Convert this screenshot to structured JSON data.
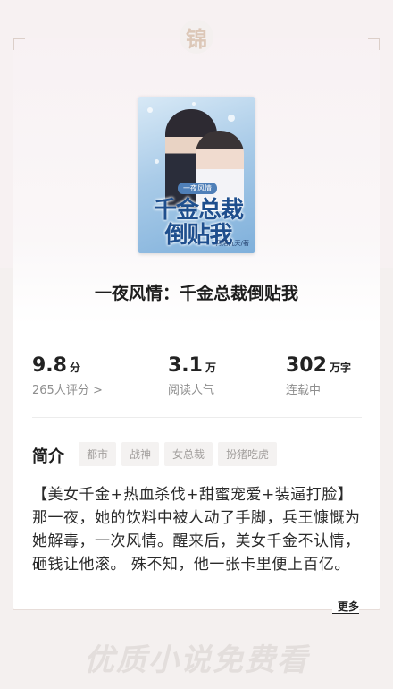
{
  "emblem": "锦",
  "book": {
    "title": "一夜风情：千金总裁倒贴我",
    "cover": {
      "tag": "一夜风情",
      "title_line1": "千金总裁",
      "title_line2": "倒贴我",
      "author": "月落九天/著"
    }
  },
  "stats": {
    "score": {
      "value": "9.8",
      "unit": "分",
      "label": "265人评分 >"
    },
    "reads": {
      "value": "3.1",
      "unit": "万",
      "label": "阅读人气"
    },
    "words": {
      "value": "302",
      "unit": "万字",
      "label": "连载中"
    }
  },
  "intro": {
    "label": "简介",
    "tags": [
      "都市",
      "战神",
      "女总裁",
      "扮猪吃虎"
    ],
    "description_line1": "【美女千金+热血杀伐+甜蜜宠爱+装逼打脸】",
    "description_line2": "那一夜，她的饮料中被人动了手脚，兵王慷慨为她解毒，一次风情。醒来后，美女千金不认情，砸钱让他滚。 殊不知，他一张卡里便上百亿。",
    "more_label": "更多"
  },
  "watermark": "优质小说免费看"
}
